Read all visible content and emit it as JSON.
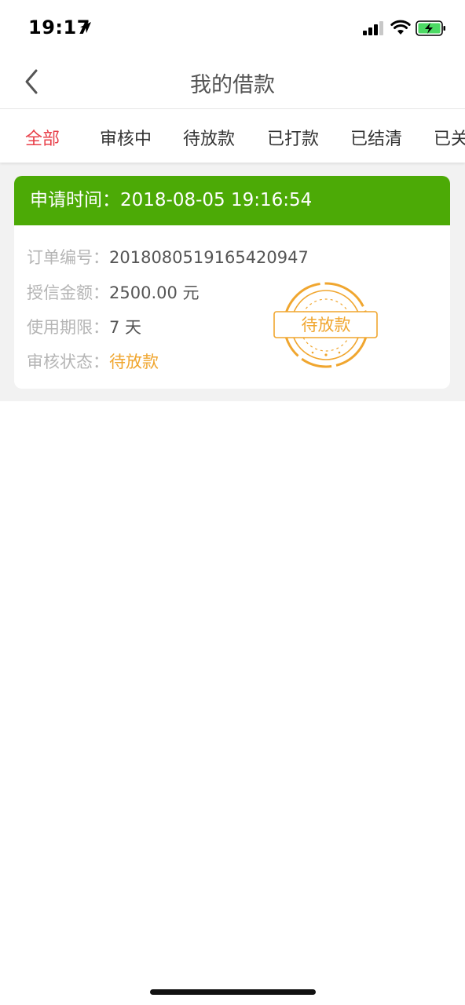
{
  "status_bar": {
    "time": "19:17"
  },
  "nav": {
    "title": "我的借款"
  },
  "tabs": [
    {
      "label": "全部",
      "active": true
    },
    {
      "label": "审核中",
      "active": false
    },
    {
      "label": "待放款",
      "active": false
    },
    {
      "label": "已打款",
      "active": false
    },
    {
      "label": "已结清",
      "active": false
    },
    {
      "label": "已关",
      "active": false
    }
  ],
  "colors": {
    "accent_red": "#e8404a",
    "header_green": "#4caa06",
    "status_orange": "#f0a62f"
  },
  "loan": {
    "header_label": "申请时间：",
    "header_value": "2018-08-05 19:16:54",
    "order_label": "订单编号：",
    "order_value": "20180805191654209 47",
    "amount_label": "授信金额：",
    "amount_value": "2500.00 元",
    "term_label": "使用期限：",
    "term_value": "7 天",
    "status_label": "审核状态：",
    "status_value": "待放款",
    "stamp_text": "待放款"
  }
}
